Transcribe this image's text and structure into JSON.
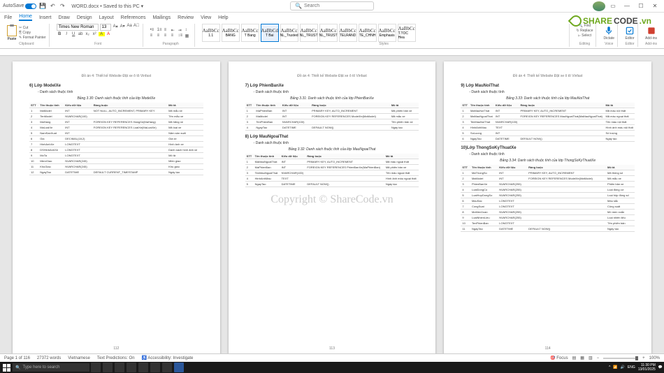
{
  "titlebar": {
    "autosave": "AutoSave",
    "doc": "WORD.docx • Saved to this PC ▾",
    "search_ph": "Search"
  },
  "menus": [
    "File",
    "Home",
    "Insert",
    "Draw",
    "Design",
    "Layout",
    "References",
    "Mailings",
    "Review",
    "View",
    "Help"
  ],
  "active_menu": 1,
  "ribbon": {
    "clipboard": {
      "paste": "Paste",
      "cut": "✂ Cut",
      "copy": "⎘ Copy",
      "fmt": "✎ Format Painter",
      "lbl": "Clipboard"
    },
    "font": {
      "name": "Times New Roman",
      "size": "13",
      "lbl": "Font"
    },
    "para": {
      "lbl": "Paragraph"
    },
    "styles": {
      "lbl": "Styles",
      "items": [
        {
          "p": "AaBbCc",
          "n": "1.1"
        },
        {
          "p": "AaBbCc",
          "n": "BANG"
        },
        {
          "p": "AaBbCc",
          "n": "T Bang"
        },
        {
          "p": "AaBbCd",
          "n": "T Bai",
          "sel": true
        },
        {
          "p": "AaBbCc",
          "n": "NL_Trusted"
        },
        {
          "p": "AaBbCc",
          "n": "NL_TRUST"
        },
        {
          "p": "AaBbCc",
          "n": "NL_TRUST"
        },
        {
          "p": "AaBbCc",
          "n": "TELRAND"
        },
        {
          "p": "AaBbCc",
          "n": "TE_CHNH"
        },
        {
          "p": "AaBbCc",
          "n": "Emphasis"
        },
        {
          "p": "AaBbCc",
          "n": "T.TOC Hea"
        }
      ]
    },
    "editing": {
      "find": "🔍 Find",
      "replace": "↻ Replace",
      "select": "▻ Select",
      "lbl": "Editing"
    },
    "voice": {
      "dictate": "Dictate",
      "lbl": "Voice"
    },
    "editor": {
      "editor": "Editor",
      "lbl": "Editor"
    },
    "addins": {
      "add": "Add-ins",
      "lbl": "Add-ins"
    }
  },
  "docs": {
    "header": "Đồ án 4: Thiết kế Website Đặt xe ô tô Vinfast",
    "p1": {
      "h": "6)  Lớp ModelXe",
      "b": "Danh sách thuộc tính",
      "cap": "Bảng 3.30: Danh sách thuộc tính của lớp ModelXe",
      "cols": [
        "STT",
        "Tên thuộc tính",
        "Kiểu dữ liệu",
        "Ràng buộc",
        "Mô tả"
      ],
      "rows": [
        [
          "1",
          "MaModel",
          "INT",
          "NOT NULL, AUTO_INCREMENT, PRIMARY KEY",
          "Mã mẫu xe"
        ],
        [
          "2",
          "TenModel",
          "NVARCHAR(100)",
          "",
          "Tên mẫu xe"
        ],
        [
          "3",
          "MaHang",
          "INT",
          "FOREIGN KEY REFERENCES HangXe(MaHang)",
          "Mã hãng xe"
        ],
        [
          "4",
          "MaLoaiXe",
          "INT",
          "FOREIGN KEY REFERENCES LoaiXe(MaLoaiXe)",
          "Mã loại xe"
        ],
        [
          "5",
          "NamSanXuat",
          "INT",
          "",
          "Năm sản xuất"
        ],
        [
          "6",
          "Gia",
          "DECIMAL(18,2)",
          "",
          "Giá xe"
        ],
        [
          "7",
          "HinhAnhXe",
          "LONGTEXT",
          "",
          "Hình ảnh xe"
        ],
        [
          "8",
          "DSHinhAnhXe",
          "LONGTEXT",
          "",
          "Danh sách hình ảnh xe"
        ],
        [
          "9",
          "MoTa",
          "LONGTEXT",
          "",
          "Mô tả"
        ],
        [
          "10",
          "MienGiao",
          "NVARCHAR(245)",
          "",
          "Miền giao"
        ],
        [
          "11",
          "KhuGiao",
          "NVARCHAR(245)",
          "",
          "Khu giao"
        ],
        [
          "12",
          "NgayTao",
          "DATETIME",
          "DEFAULT CURRENT_TIMESTAMP",
          "Ngày tạo"
        ]
      ],
      "num": "112"
    },
    "p2": {
      "h1": "7)  Lớp PhienBanXe",
      "b1": "Danh sách thuộc tính",
      "cap1": "Bảng 3.31: Danh sách thuộc tính của lớp PhienBanXe",
      "rows1": [
        [
          "1",
          "MaPhienBan",
          "INT",
          "PRIMARY KEY, AUTO_INCREMENT",
          "Mã phiên bản xe"
        ],
        [
          "2",
          "MaModel",
          "INT",
          "FOREIGN KEY REFERENCES ModelXe(MaModel)",
          "Mã mẫu xe"
        ],
        [
          "3",
          "TenPhienBan",
          "NVARCHAR(100)",
          "",
          "Tên phiên bản xe"
        ],
        [
          "4",
          "NgayTao",
          "DATETIME",
          "DEFAULT NOW()",
          "Ngày tạo"
        ]
      ],
      "h2": "8)  Lớp MauNgoaiThat",
      "b2": "Danh sách thuộc tính",
      "cap2": "Bảng 3.32: Danh sách thuộc tính của lớp MauNgoaiThat",
      "rows2": [
        [
          "1",
          "MaMauNgoaiThat",
          "INT",
          "PRIMARY KEY, AUTO_INCREMENT",
          "Mã màu ngoại thất"
        ],
        [
          "2",
          "MaPhienBan",
          "INT",
          "FOREIGN KEY REFERENCES PhienBanXe(MaPhienBan)",
          "Mã phiên bản xe"
        ],
        [
          "3",
          "TenMauNgoaiThat",
          "NVARCHAR(100)",
          "",
          "Tên màu ngoại thất"
        ],
        [
          "4",
          "HinhAnhMau",
          "TEXT",
          "",
          "Hình ảnh màu ngoại thất"
        ],
        [
          "5",
          "NgayTao",
          "DATETIME",
          "DEFAULT NOW()",
          "Ngày tạo"
        ]
      ],
      "num": "113"
    },
    "p3": {
      "h1": "9)  Lớp MauNoiThat",
      "b1": "Danh sách thuộc tính",
      "cap1": "Bảng 3.33: Danh sách thuộc tính của lớp MauNoiThat",
      "rows1": [
        [
          "1",
          "MaMauNoiThat",
          "INT",
          "PRIMARY KEY, AUTO_INCREMENT",
          "Mã màu nội thất"
        ],
        [
          "2",
          "MaMauNgoaiThat",
          "INT",
          "FOREIGN KEY REFERENCES MauNgoaiThat(MaMauNgoaiThat)",
          "Mã màu ngoại thất"
        ],
        [
          "3",
          "TenMauNoiThat",
          "NVARCHAR(100)",
          "",
          "Tên màu nội thất"
        ],
        [
          "4",
          "HinhAnhMau",
          "TEXT",
          "",
          "Hình ảnh màu nội thất"
        ],
        [
          "5",
          "SoLuong",
          "INT",
          "",
          "Số lượng"
        ],
        [
          "6",
          "NgayTao",
          "DATETIME",
          "DEFAULT NOW()",
          "Ngày tạo"
        ]
      ],
      "h2": "10)Lớp ThongSoKyThuatXe",
      "b2": "Danh sách thuộc tính",
      "cap2": "Bảng 3.34: Danh sách thuộc tính của lớp ThongSoKyThuatXe",
      "rows2": [
        [
          "1",
          "MaThongSo",
          "INT",
          "PRIMARY KEY, AUTO_INCREMENT",
          "Mã thông số"
        ],
        [
          "2",
          "MaModel",
          "INT",
          "FOREIGN KEY REFERENCES ModelXe(MaModel)",
          "Mã mẫu xe"
        ],
        [
          "3",
          "PhienBanXe",
          "NVARCHAR(255)",
          "",
          "Phiên bản xe"
        ],
        [
          "4",
          "LoaiDongCo",
          "NVARCHAR(255)",
          "",
          "Loại động cơ"
        ],
        [
          "5",
          "LoaiHopDongSo",
          "NVARCHAR(255)",
          "",
          "Loại hộp đồng số"
        ],
        [
          "6",
          "MauSac",
          "LONGTEXT",
          "",
          "Màu sắc"
        ],
        [
          "7",
          "CongSuat",
          "LONGTEXT",
          "",
          "Công suất"
        ],
        [
          "8",
          "MoMenXoan",
          "NVARCHAR(255)",
          "",
          "Mô men xoắn"
        ],
        [
          "9",
          "LoaiNhienLieu",
          "NVARCHAR(255)",
          "",
          "Loại nhiên liệu"
        ],
        [
          "10",
          "TenPhienBan",
          "LONGTEXT",
          "",
          "Tên phiên bản"
        ],
        [
          "11",
          "NgayTao",
          "DATETIME",
          "DEFAULT NOW()",
          "Ngày tạo"
        ]
      ],
      "num": "114"
    }
  },
  "watermark": "Copyright © ShareCode.vn",
  "logo": {
    "a": "SHARE",
    "b": "CODE",
    "c": ".vn"
  },
  "status": {
    "page": "Page 1 of 116",
    "words": "27372 words",
    "lang": "Vietnamese",
    "pred": "Text Predictions: On",
    "acc": "♿ Accessibility: Investigate",
    "focus": "🎯 Focus",
    "zoom": "100%"
  },
  "taskbar": {
    "search": "Type here to search",
    "time": "11:30 PM",
    "date": "13/01/2025"
  }
}
